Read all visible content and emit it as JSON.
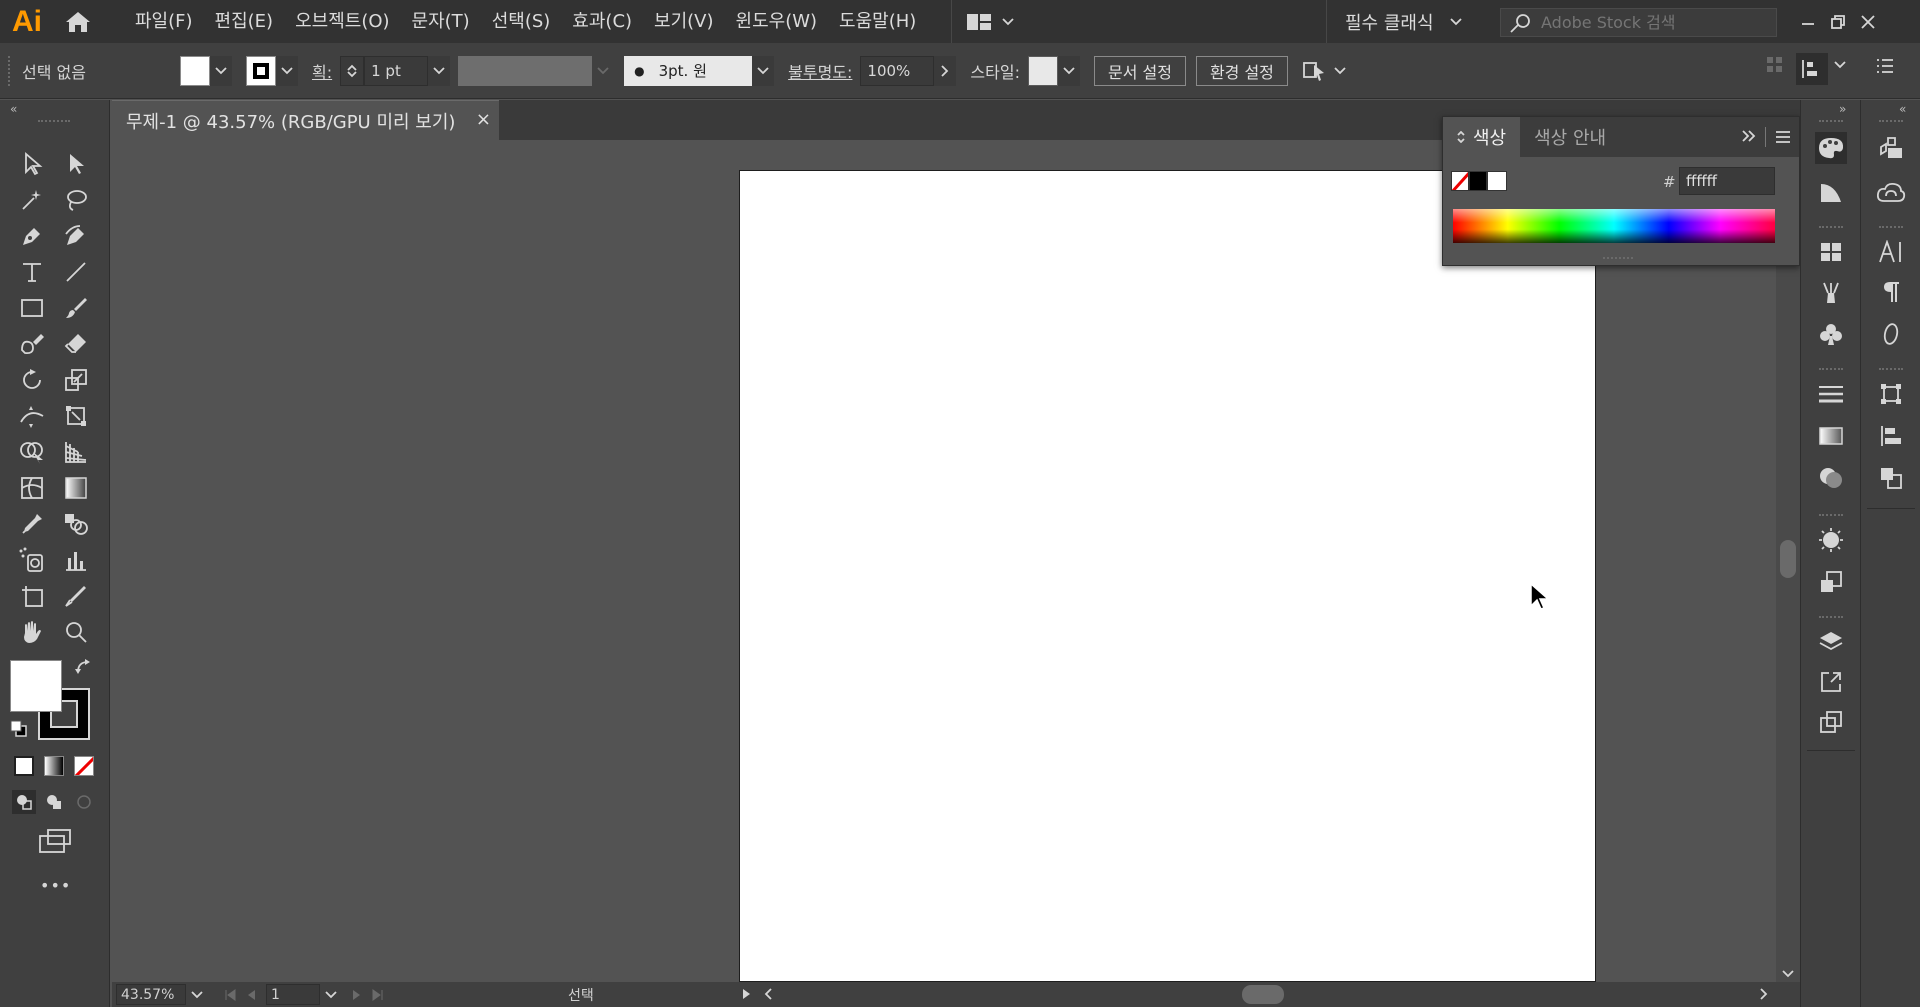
{
  "app": {
    "logo_text": "Ai",
    "menus": [
      "파일(F)",
      "편집(E)",
      "오브젝트(O)",
      "문자(T)",
      "선택(S)",
      "효과(C)",
      "보기(V)",
      "윈도우(W)",
      "도움말(H)"
    ],
    "workspace_label": "필수 클래식",
    "stock_search_placeholder": "Adobe Stock 검색"
  },
  "control_bar": {
    "selection_status": "선택 없음",
    "stroke_label": "획:",
    "stroke_weight": "1 pt",
    "brush_label": "3pt. 원",
    "opacity_label": "불투명도:",
    "opacity_value": "100%",
    "style_label": "스타일:",
    "doc_setup_button": "문서 설정",
    "preferences_button": "환경 설정"
  },
  "document": {
    "tab_title": "무제-1 @ 43.57% (RGB/GPU 미리 보기)",
    "close_glyph": "×"
  },
  "status_bar": {
    "zoom": "43.57%",
    "artboard_number": "1",
    "tool_status": "선택"
  },
  "color_panel": {
    "tabs": [
      "색상",
      "색상 안내"
    ],
    "hex_prefix": "#",
    "hex_value": "ffffff",
    "colors": {
      "fill": "#ffffff",
      "stroke": "#000000"
    }
  },
  "toolbar": {
    "more_glyph": "•••"
  }
}
